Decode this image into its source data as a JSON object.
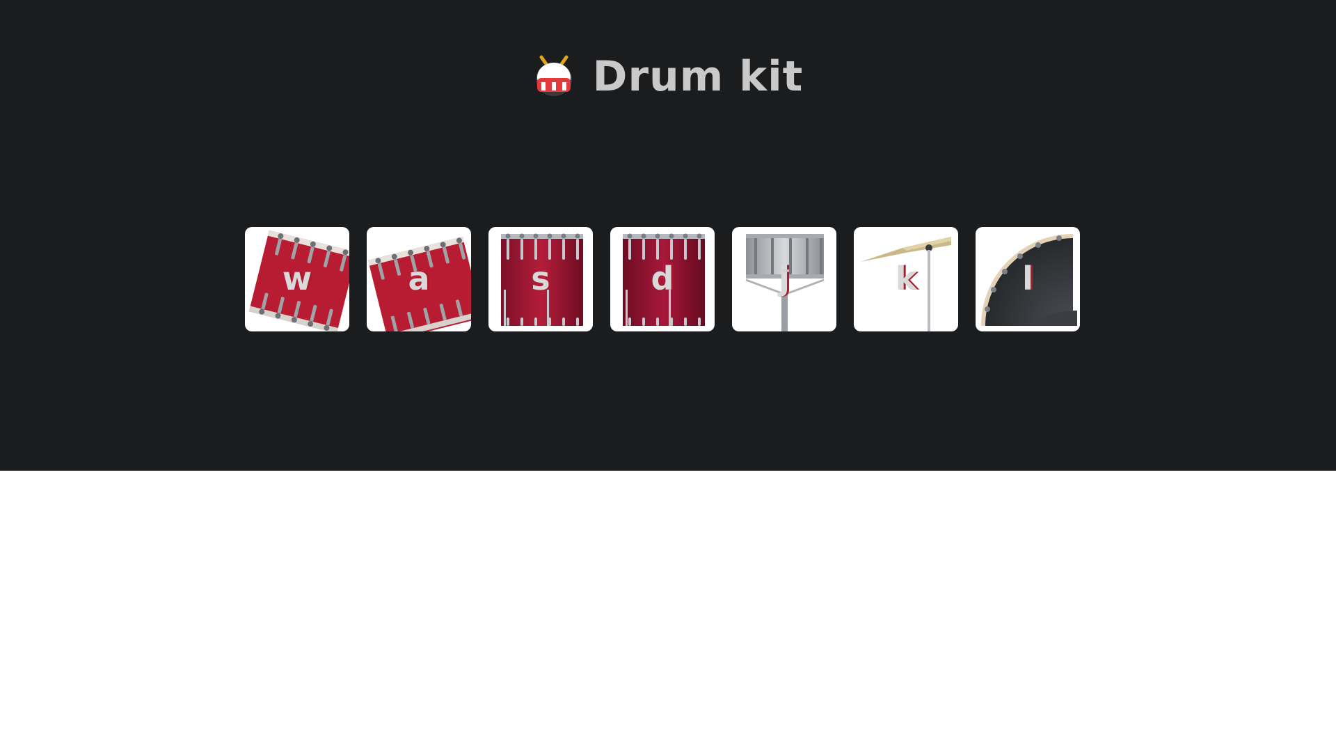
{
  "header": {
    "title": "Drum kit",
    "icon": "drum-emoji-icon"
  },
  "pads": [
    {
      "key": "w",
      "instrument": "tom-tilted-left-icon"
    },
    {
      "key": "a",
      "instrument": "tom-tilted-right-icon"
    },
    {
      "key": "s",
      "instrument": "floor-tom-icon"
    },
    {
      "key": "d",
      "instrument": "floor-tom-icon"
    },
    {
      "key": "j",
      "instrument": "snare-drum-icon"
    },
    {
      "key": "k",
      "instrument": "crash-cymbal-icon"
    },
    {
      "key": "l",
      "instrument": "bass-drum-icon"
    }
  ],
  "colors": {
    "background": "#1b1c1e",
    "title": "#c9c9c9",
    "drum_red": "#b0182a",
    "pad": "#ffffff"
  }
}
